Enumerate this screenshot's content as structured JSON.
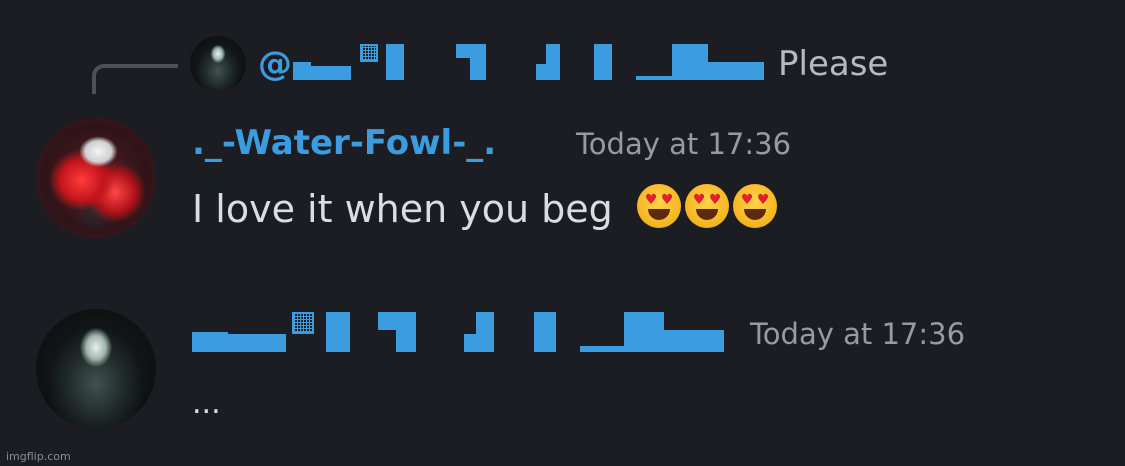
{
  "reply": {
    "prefix": "@",
    "preview_text": "Please"
  },
  "messages": [
    {
      "author": "._-Water-Fowl-_.",
      "author_color": "#3b9ce0",
      "timestamp": "Today at 17:36",
      "text": "I love it when you beg",
      "emoji": [
        "heart-eyes-emoji",
        "heart-eyes-emoji",
        "heart-eyes-emoji"
      ]
    },
    {
      "author_redacted": true,
      "timestamp": "Today at 17:36",
      "text": "..."
    }
  ],
  "watermark": "imgflip.com",
  "colors": {
    "background": "#1c1d22",
    "username_blue": "#3b9ce0",
    "timestamp_gray": "#949ba4",
    "message_text": "#dbdee1"
  }
}
